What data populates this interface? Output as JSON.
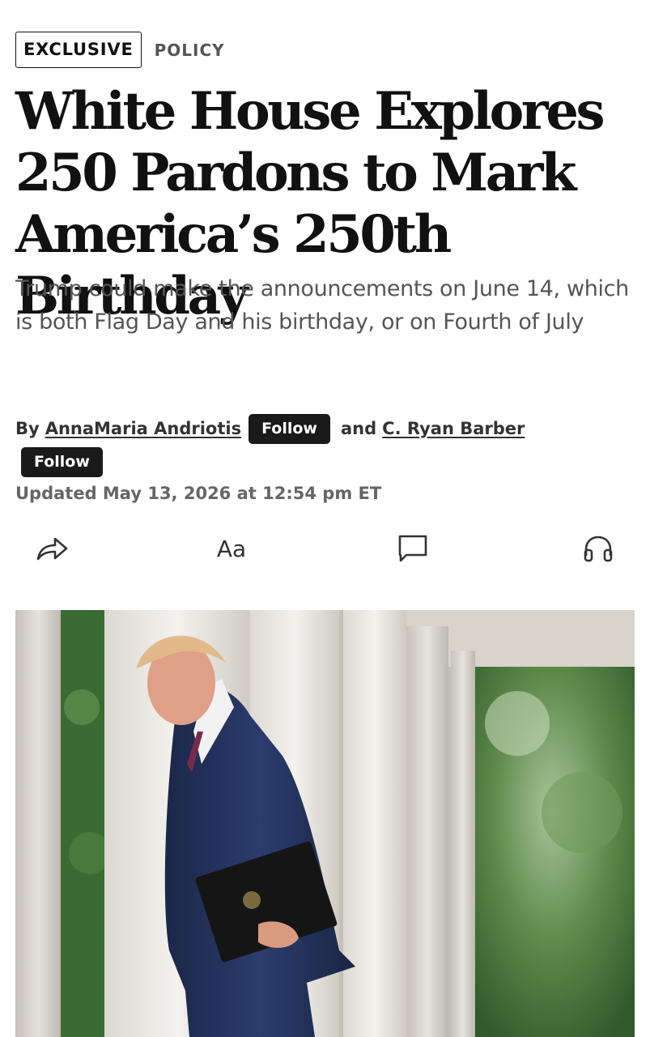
{
  "tags": {
    "primary": "EXCLUSIVE",
    "section": "POLICY"
  },
  "article": {
    "headline": "White House Explores 250 Pardons to Mark America’s 250th Birthday",
    "dek": "Trump could make the announcements on June 14, which is both Flag Day and his birthday, or on Fourth of July"
  },
  "byline": {
    "by": "By",
    "author1": "AnnaMaria Andriotis",
    "and": "and",
    "author2": "C. Ryan Barber",
    "follow_label": "Follow"
  },
  "updated": "Updated May 13, 2026 at 12:54 pm ET",
  "toolbar": {
    "text_size_label": "Aa",
    "icons": [
      "share-icon",
      "text-size-icon",
      "comment-icon",
      "headphones-icon"
    ]
  },
  "colors": {
    "text": "#111111",
    "muted": "#555555",
    "button_bg": "#1a1a1a",
    "button_text": "#ffffff"
  }
}
